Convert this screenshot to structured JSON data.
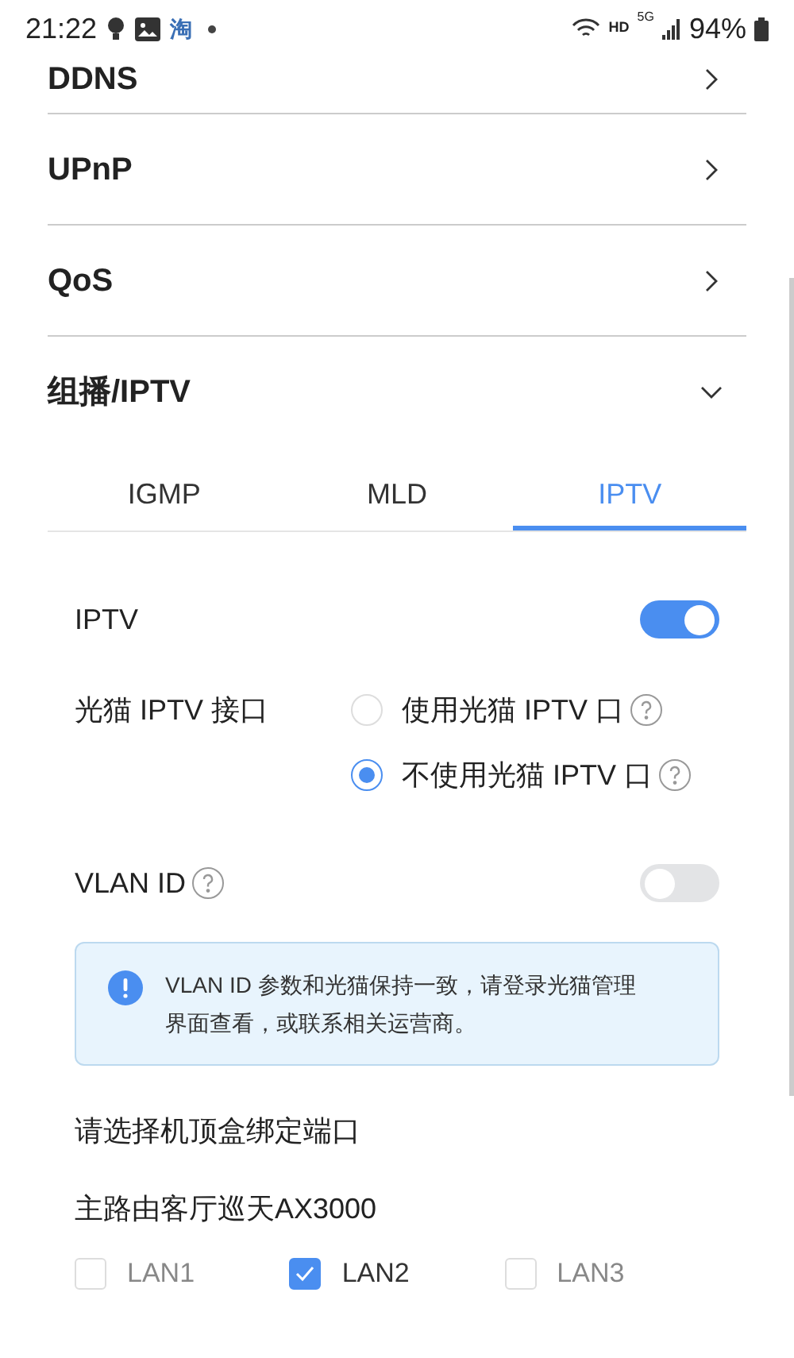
{
  "status_bar": {
    "time": "21:22",
    "app_icon_text": "淘",
    "network_badge": "HD",
    "signal_badge": "5G",
    "battery": "94%"
  },
  "menu": [
    {
      "label": "DDNS",
      "expanded": false
    },
    {
      "label": "UPnP",
      "expanded": false
    },
    {
      "label": "QoS",
      "expanded": false
    },
    {
      "label": "组播/IPTV",
      "expanded": true
    }
  ],
  "tabs": [
    {
      "label": "IGMP",
      "selected": false
    },
    {
      "label": "MLD",
      "selected": false
    },
    {
      "label": "IPTV",
      "selected": true
    }
  ],
  "iptv": {
    "label": "IPTV",
    "on": true
  },
  "modem_port": {
    "label": "光猫 IPTV 接口",
    "options": [
      {
        "label": "使用光猫 IPTV 口",
        "selected": false
      },
      {
        "label": "不使用光猫 IPTV 口",
        "selected": true
      }
    ]
  },
  "vlan": {
    "label": "VLAN ID",
    "on": false
  },
  "notice": "VLAN ID 参数和光猫保持一致，请登录光猫管理界面查看，或联系相关运营商。",
  "bind_title": "请选择机顶盒绑定端口",
  "router_name": "主路由客厅巡天AX3000",
  "ports": [
    {
      "label": "LAN1",
      "checked": false
    },
    {
      "label": "LAN2",
      "checked": true
    },
    {
      "label": "LAN3",
      "checked": false
    }
  ]
}
